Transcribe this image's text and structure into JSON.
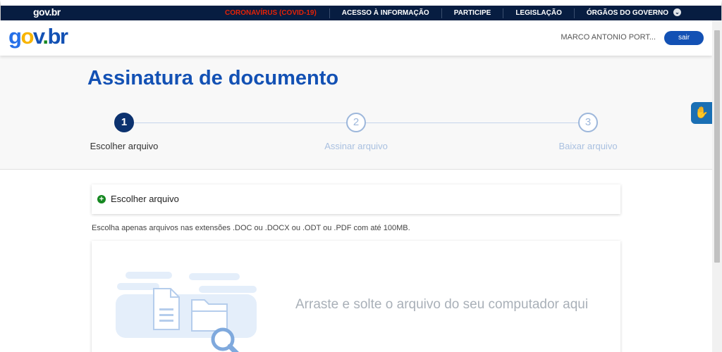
{
  "gov_bar": {
    "brand": "gov.br",
    "links": [
      "CORONAVÍRUS (COVID-19)",
      "ACESSO À INFORMAÇÃO",
      "PARTICIPE",
      "LEGISLAÇÃO",
      "ÓRGÃOS DO GOVERNO"
    ],
    "covid_color": "#e52207"
  },
  "header": {
    "logo": {
      "g": "g",
      "o": "o",
      "v": "v",
      "dot": ".",
      "b": "b",
      "r": "r"
    },
    "user_name": "MARCO ANTONIO PORT...",
    "logout_label": "sair"
  },
  "page": {
    "title": "Assinatura de documento",
    "steps": [
      {
        "number": "1",
        "label": "Escolher arquivo",
        "state": "active"
      },
      {
        "number": "2",
        "label": "Assinar arquivo",
        "state": "inactive"
      },
      {
        "number": "3",
        "label": "Baixar arquivo",
        "state": "inactive"
      }
    ]
  },
  "upload": {
    "choose_label": "Escolher arquivo",
    "hint": "Escolha apenas arquivos nas extensões .DOC ou .DOCX ou .ODT ou .PDF com até 100MB.",
    "drop_text": "Arraste e solte o arquivo do seu computador aqui"
  },
  "colors": {
    "primary": "#1351b4",
    "navy": "#071d41",
    "success": "#168821"
  },
  "icons": [
    "chevron-down-icon",
    "plus-circle-icon",
    "hand-sign-icon",
    "document-icon",
    "folder-icon",
    "magnifier-icon"
  ]
}
